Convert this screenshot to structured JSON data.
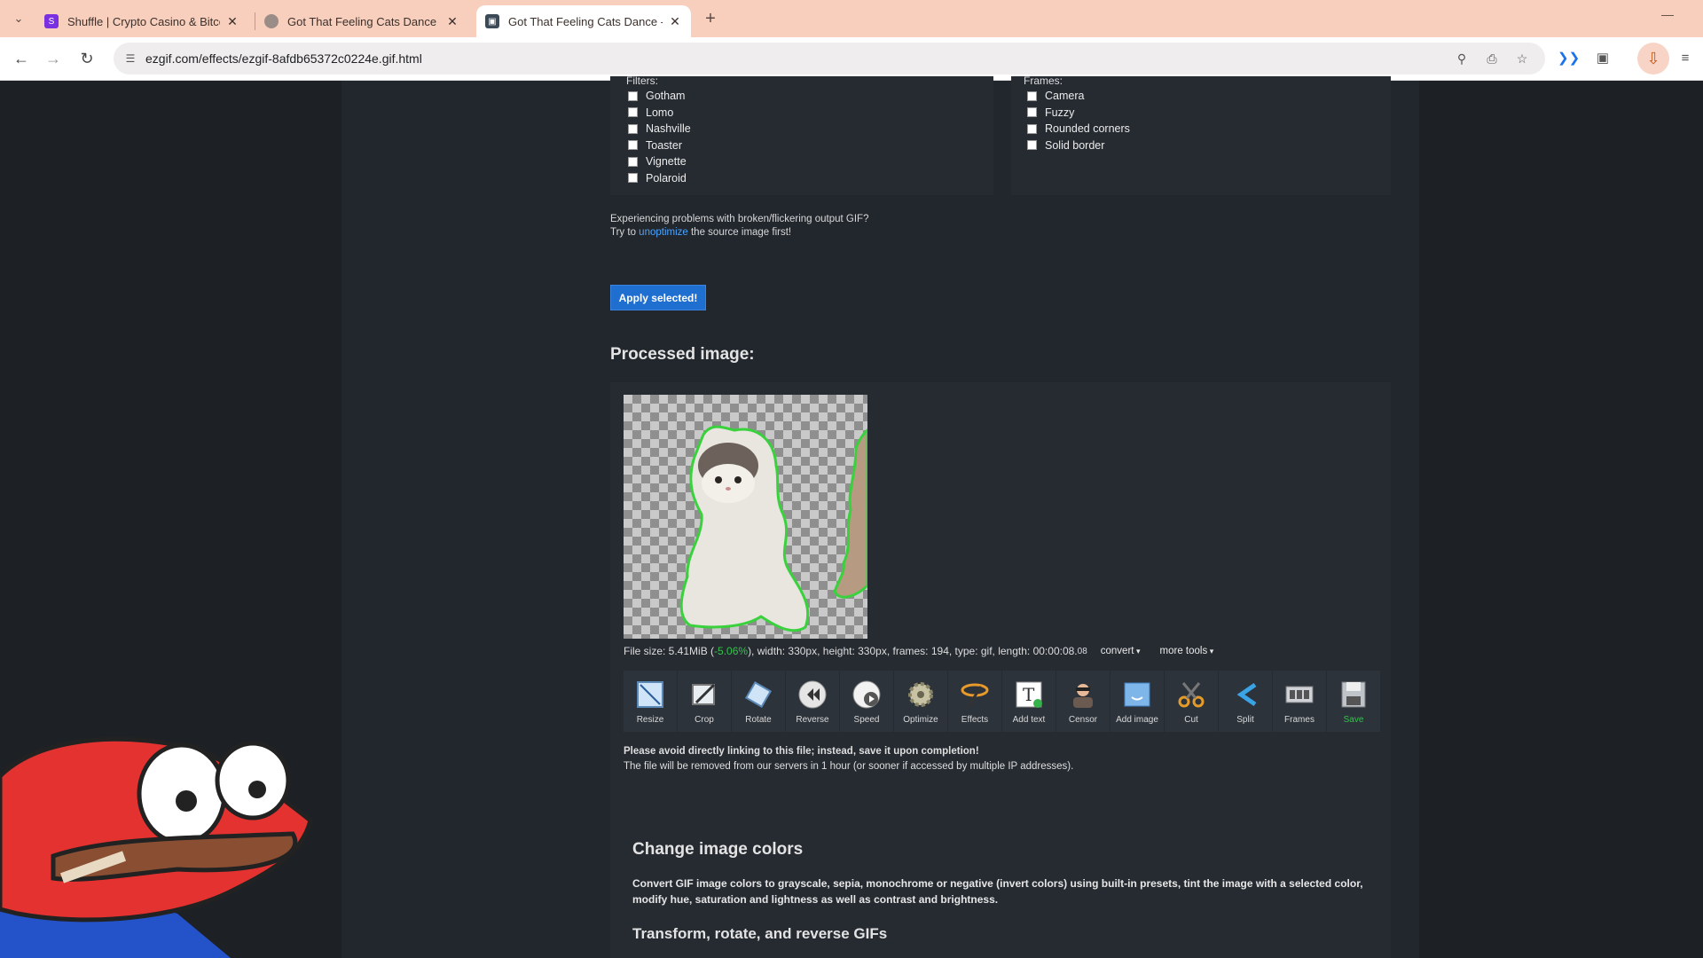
{
  "browser": {
    "tabs": [
      {
        "title": "Shuffle | Crypto Casino & Bitcoi",
        "active": false
      },
      {
        "title": "Got That Feeling Cats Dance - G",
        "active": false
      },
      {
        "title": "Got That Feeling Cats Dance - G",
        "active": true
      }
    ],
    "url": "ezgif.com/effects/ezgif-8afdb65372c0224e.gif.html"
  },
  "filters": {
    "caption": "Filters:",
    "items": [
      "Gotham",
      "Lomo",
      "Nashville",
      "Toaster",
      "Vignette",
      "Polaroid"
    ]
  },
  "frames": {
    "caption": "Frames:",
    "items": [
      "Camera",
      "Fuzzy",
      "Rounded corners",
      "Solid border"
    ]
  },
  "note": {
    "line1": "Experiencing problems with broken/flickering output GIF?",
    "line2_pre": "Try to ",
    "link": "unoptimize",
    "line2_post": " the source image first!"
  },
  "apply_label": "Apply selected!",
  "processed_heading": "Processed image:",
  "fileinfo": {
    "pre": "File size: 5.41MiB (",
    "change": "-5.06%",
    "mid": "), width: 330px, height: 330px, frames: 194, type: gif, length: 00:00:08.",
    "ms": "08",
    "convert": "convert",
    "more": "more tools"
  },
  "tools": [
    "Resize",
    "Crop",
    "Rotate",
    "Reverse",
    "Speed",
    "Optimize",
    "Effects",
    "Add text",
    "Censor",
    "Add image",
    "Cut",
    "Split",
    "Frames",
    "Save"
  ],
  "warning": {
    "line1": "Please avoid directly linking to this file; instead, save it upon completion!",
    "line2": "The file will be removed from our servers in 1 hour (or sooner if accessed by multiple IP addresses)."
  },
  "colors_heading": "Change image colors",
  "colors_desc": "Convert GIF image colors to grayscale, sepia, monochrome or negative (invert colors) using built-in presets, tint the image with a selected color, modify hue, saturation and lightness as well as contrast and brightness.",
  "transform_heading": "Transform, rotate, and reverse GIFs",
  "colors": {
    "accent": "#1f6fd1",
    "tabbar": "#f8cfbd",
    "page_bg": "#1d2126",
    "save_green": "#33c14b",
    "link": "#4aa3ff"
  }
}
